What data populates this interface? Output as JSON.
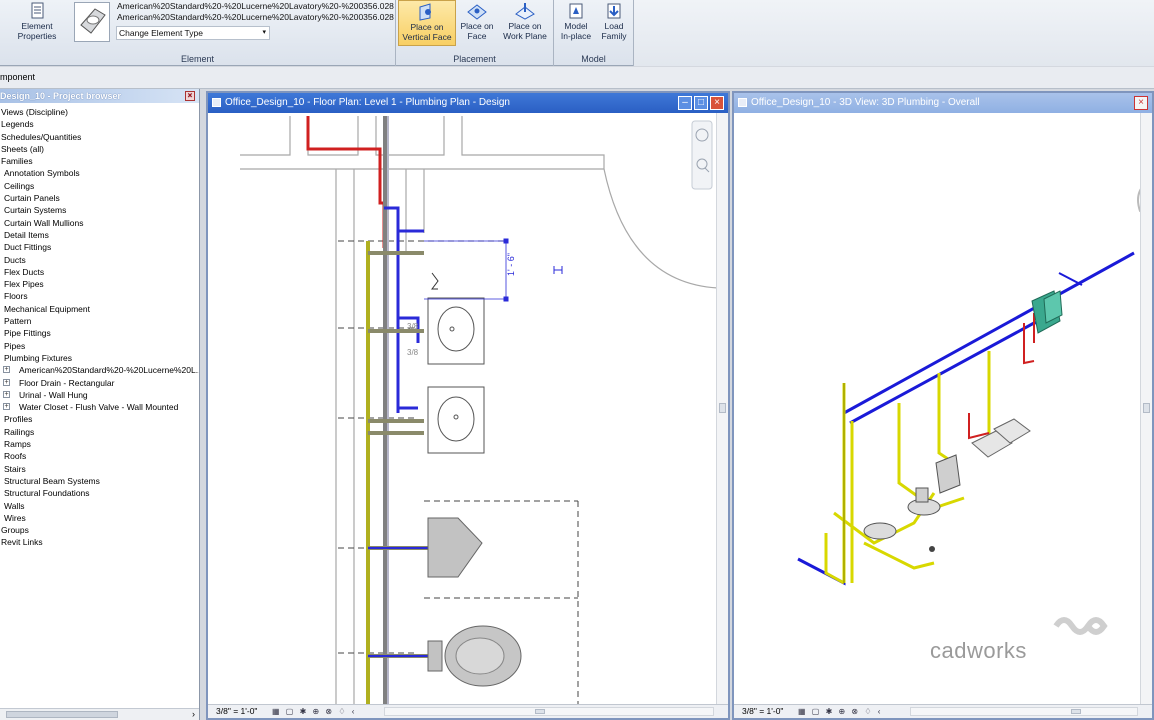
{
  "ribbon": {
    "element_group": {
      "label": "Element",
      "element_properties_label": "Element\nProperties",
      "family_line1": "American%20Standard%20-%20Lucerne%20Lavatory%20-%200356.028",
      "family_line2": "American%20Standard%20-%20Lucerne%20Lavatory%20-%200356.028",
      "change_type_label": "Change Element Type"
    },
    "placement_group": {
      "label": "Placement",
      "buttons": [
        {
          "label": "Place on\nVertical Face",
          "active": true
        },
        {
          "label": "Place on\nFace",
          "active": false
        },
        {
          "label": "Place on\nWork Plane",
          "active": false
        }
      ]
    },
    "model_group": {
      "label": "Model",
      "buttons": [
        {
          "label": "Model\nIn-place"
        },
        {
          "label": "Load\nFamily"
        }
      ]
    }
  },
  "options_bar": {
    "text": "mponent"
  },
  "project_browser": {
    "title": "Design_10 - Project browser",
    "items": [
      {
        "label": "Views (Discipline)",
        "level": 0
      },
      {
        "label": "Legends",
        "level": 0
      },
      {
        "label": "Schedules/Quantities",
        "level": 0
      },
      {
        "label": "Sheets (all)",
        "level": 0
      },
      {
        "label": "Families",
        "level": 0
      },
      {
        "label": "Annotation Symbols",
        "level": 1
      },
      {
        "label": "Ceilings",
        "level": 1
      },
      {
        "label": "Curtain Panels",
        "level": 1
      },
      {
        "label": "Curtain Systems",
        "level": 1
      },
      {
        "label": "Curtain Wall Mullions",
        "level": 1
      },
      {
        "label": "Detail Items",
        "level": 1
      },
      {
        "label": "Duct Fittings",
        "level": 1
      },
      {
        "label": "Ducts",
        "level": 1
      },
      {
        "label": "Flex Ducts",
        "level": 1
      },
      {
        "label": "Flex Pipes",
        "level": 1
      },
      {
        "label": "Floors",
        "level": 1
      },
      {
        "label": "Mechanical Equipment",
        "level": 1
      },
      {
        "label": "Pattern",
        "level": 1
      },
      {
        "label": "Pipe Fittings",
        "level": 1
      },
      {
        "label": "Pipes",
        "level": 1
      },
      {
        "label": "Plumbing Fixtures",
        "level": 1
      },
      {
        "label": "American%20Standard%20-%20Lucerne%20L...",
        "level": 2
      },
      {
        "label": "Floor Drain - Rectangular",
        "level": 2
      },
      {
        "label": "Urinal - Wall Hung",
        "level": 2
      },
      {
        "label": "Water Closet - Flush Valve - Wall Mounted",
        "level": 2
      },
      {
        "label": "Profiles",
        "level": 1
      },
      {
        "label": "Railings",
        "level": 1
      },
      {
        "label": "Ramps",
        "level": 1
      },
      {
        "label": "Roofs",
        "level": 1
      },
      {
        "label": "Stairs",
        "level": 1
      },
      {
        "label": "Structural Beam Systems",
        "level": 1
      },
      {
        "label": "Structural Foundations",
        "level": 1
      },
      {
        "label": "Walls",
        "level": 1
      },
      {
        "label": "Wires",
        "level": 1
      },
      {
        "label": "Groups",
        "level": 0
      },
      {
        "label": "Revit Links",
        "level": 0
      }
    ]
  },
  "floor_plan_view": {
    "title": "Office_Design_10 - Floor Plan: Level 1 - Plumbing Plan - Design",
    "scale": "3/8\" = 1'-0\"",
    "dimension_label": "1' - 6\"",
    "pipe_labels": [
      "3/8",
      "3/8"
    ]
  },
  "view_3d": {
    "title": "Office_Design_10 - 3D View: 3D Plumbing - Overall",
    "scale": "3/8\" = 1'-0\""
  },
  "watermark": {
    "text": "cadworks"
  },
  "colors": {
    "active_title": "#2a5fc4",
    "inactive_title": "#8fb0e3",
    "pipe_blue": "#1a1ad8",
    "pipe_yellow": "#d8d800",
    "pipe_red": "#d02020"
  }
}
